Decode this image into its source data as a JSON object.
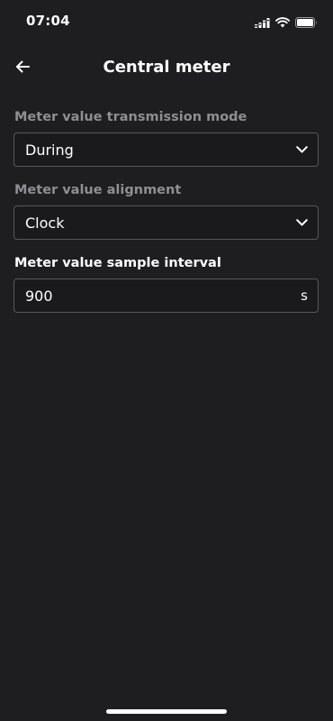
{
  "status_bar": {
    "time": "07:04",
    "icons": [
      "cellular-signal-icon",
      "wifi-icon",
      "battery-icon"
    ]
  },
  "header": {
    "title": "Central meter",
    "back_icon": "arrow-left-icon"
  },
  "form": {
    "transmission_mode": {
      "label": "Meter value transmission mode",
      "value": "During",
      "icon": "chevron-down-icon"
    },
    "alignment": {
      "label": "Meter value alignment",
      "value": "Clock",
      "icon": "chevron-down-icon"
    },
    "sample_interval": {
      "label": "Meter value sample interval",
      "value": "900",
      "unit": "s"
    }
  },
  "colors": {
    "background": "#1e1e20",
    "field_border": "#58585c",
    "muted_label": "#8e8e93",
    "text": "#ffffff"
  }
}
